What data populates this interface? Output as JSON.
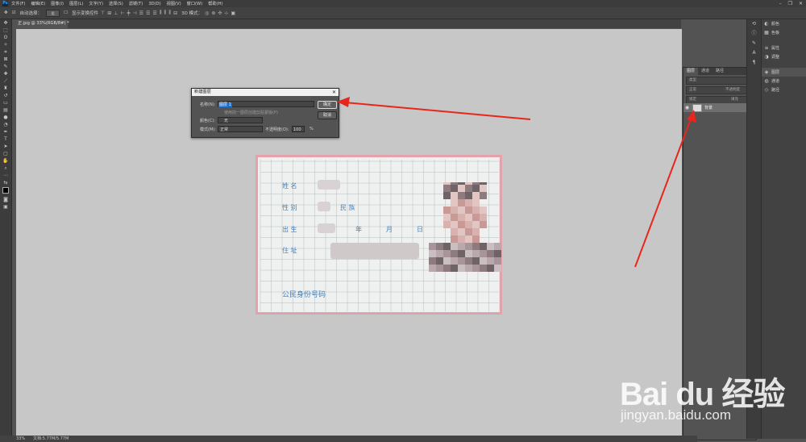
{
  "menu": {
    "app_icon": "Ps",
    "items": [
      "文件(F)",
      "编辑(E)",
      "图像(I)",
      "图层(L)",
      "文字(Y)",
      "选择(S)",
      "滤镜(T)",
      "3D(D)",
      "视图(V)",
      "窗口(W)",
      "帮助(H)"
    ]
  },
  "window_controls": {
    "minimize": "–",
    "restore": "❐",
    "close": "✕"
  },
  "options_bar": {
    "auto_select_label": "自动选择：",
    "auto_select_value": "组",
    "show_transform_label": "显示变换控件",
    "mode_3d_label": "3D 模式："
  },
  "document": {
    "tab_title": "正.jpg @ 33%(RGB/8#) *"
  },
  "dialog": {
    "title": "新建图层",
    "name_label": "名称(N):",
    "name_value": "图层 1",
    "clipping_hint": "使用前一图层创建剪贴蒙版(P)",
    "color_label": "颜色(C):",
    "color_value": "无",
    "mode_label": "模式(M):",
    "mode_value": "正常",
    "opacity_label": "不透明度(O):",
    "opacity_value": "100",
    "opacity_unit": "%",
    "ok_label": "确定",
    "cancel_label": "取消"
  },
  "idcard": {
    "name_label": "姓 名",
    "sex_label": "性 别",
    "ethnicity_label": "民 族",
    "birth_label": "出 生",
    "year_label": "年",
    "month_label": "月",
    "day_label": "日",
    "address_label": "住 址",
    "id_number_label": "公民身份号码"
  },
  "right_dock": {
    "group1": [
      "颜色",
      "色板"
    ],
    "group2": [
      "属性",
      "调整"
    ],
    "group3": [
      "图层",
      "通道",
      "路径"
    ]
  },
  "layers_panel": {
    "tabs": [
      "图层",
      "通道",
      "路径"
    ],
    "kind_placeholder": "类型",
    "blend_mode": "正常",
    "opacity_label": "不透明度",
    "lock_label": "锁定",
    "fill_label": "填充",
    "layer_name": "背景"
  },
  "status_bar": {
    "zoom": "33%",
    "doc_info": "文档:5.77M/5.77M"
  },
  "watermark": {
    "main": "Bai du 经验",
    "sub": "jingyan.baidu.com"
  },
  "colors": {
    "arrow": "#e8261c",
    "card_text": "#4a7fb4",
    "canvas": "#c7c7c7"
  }
}
